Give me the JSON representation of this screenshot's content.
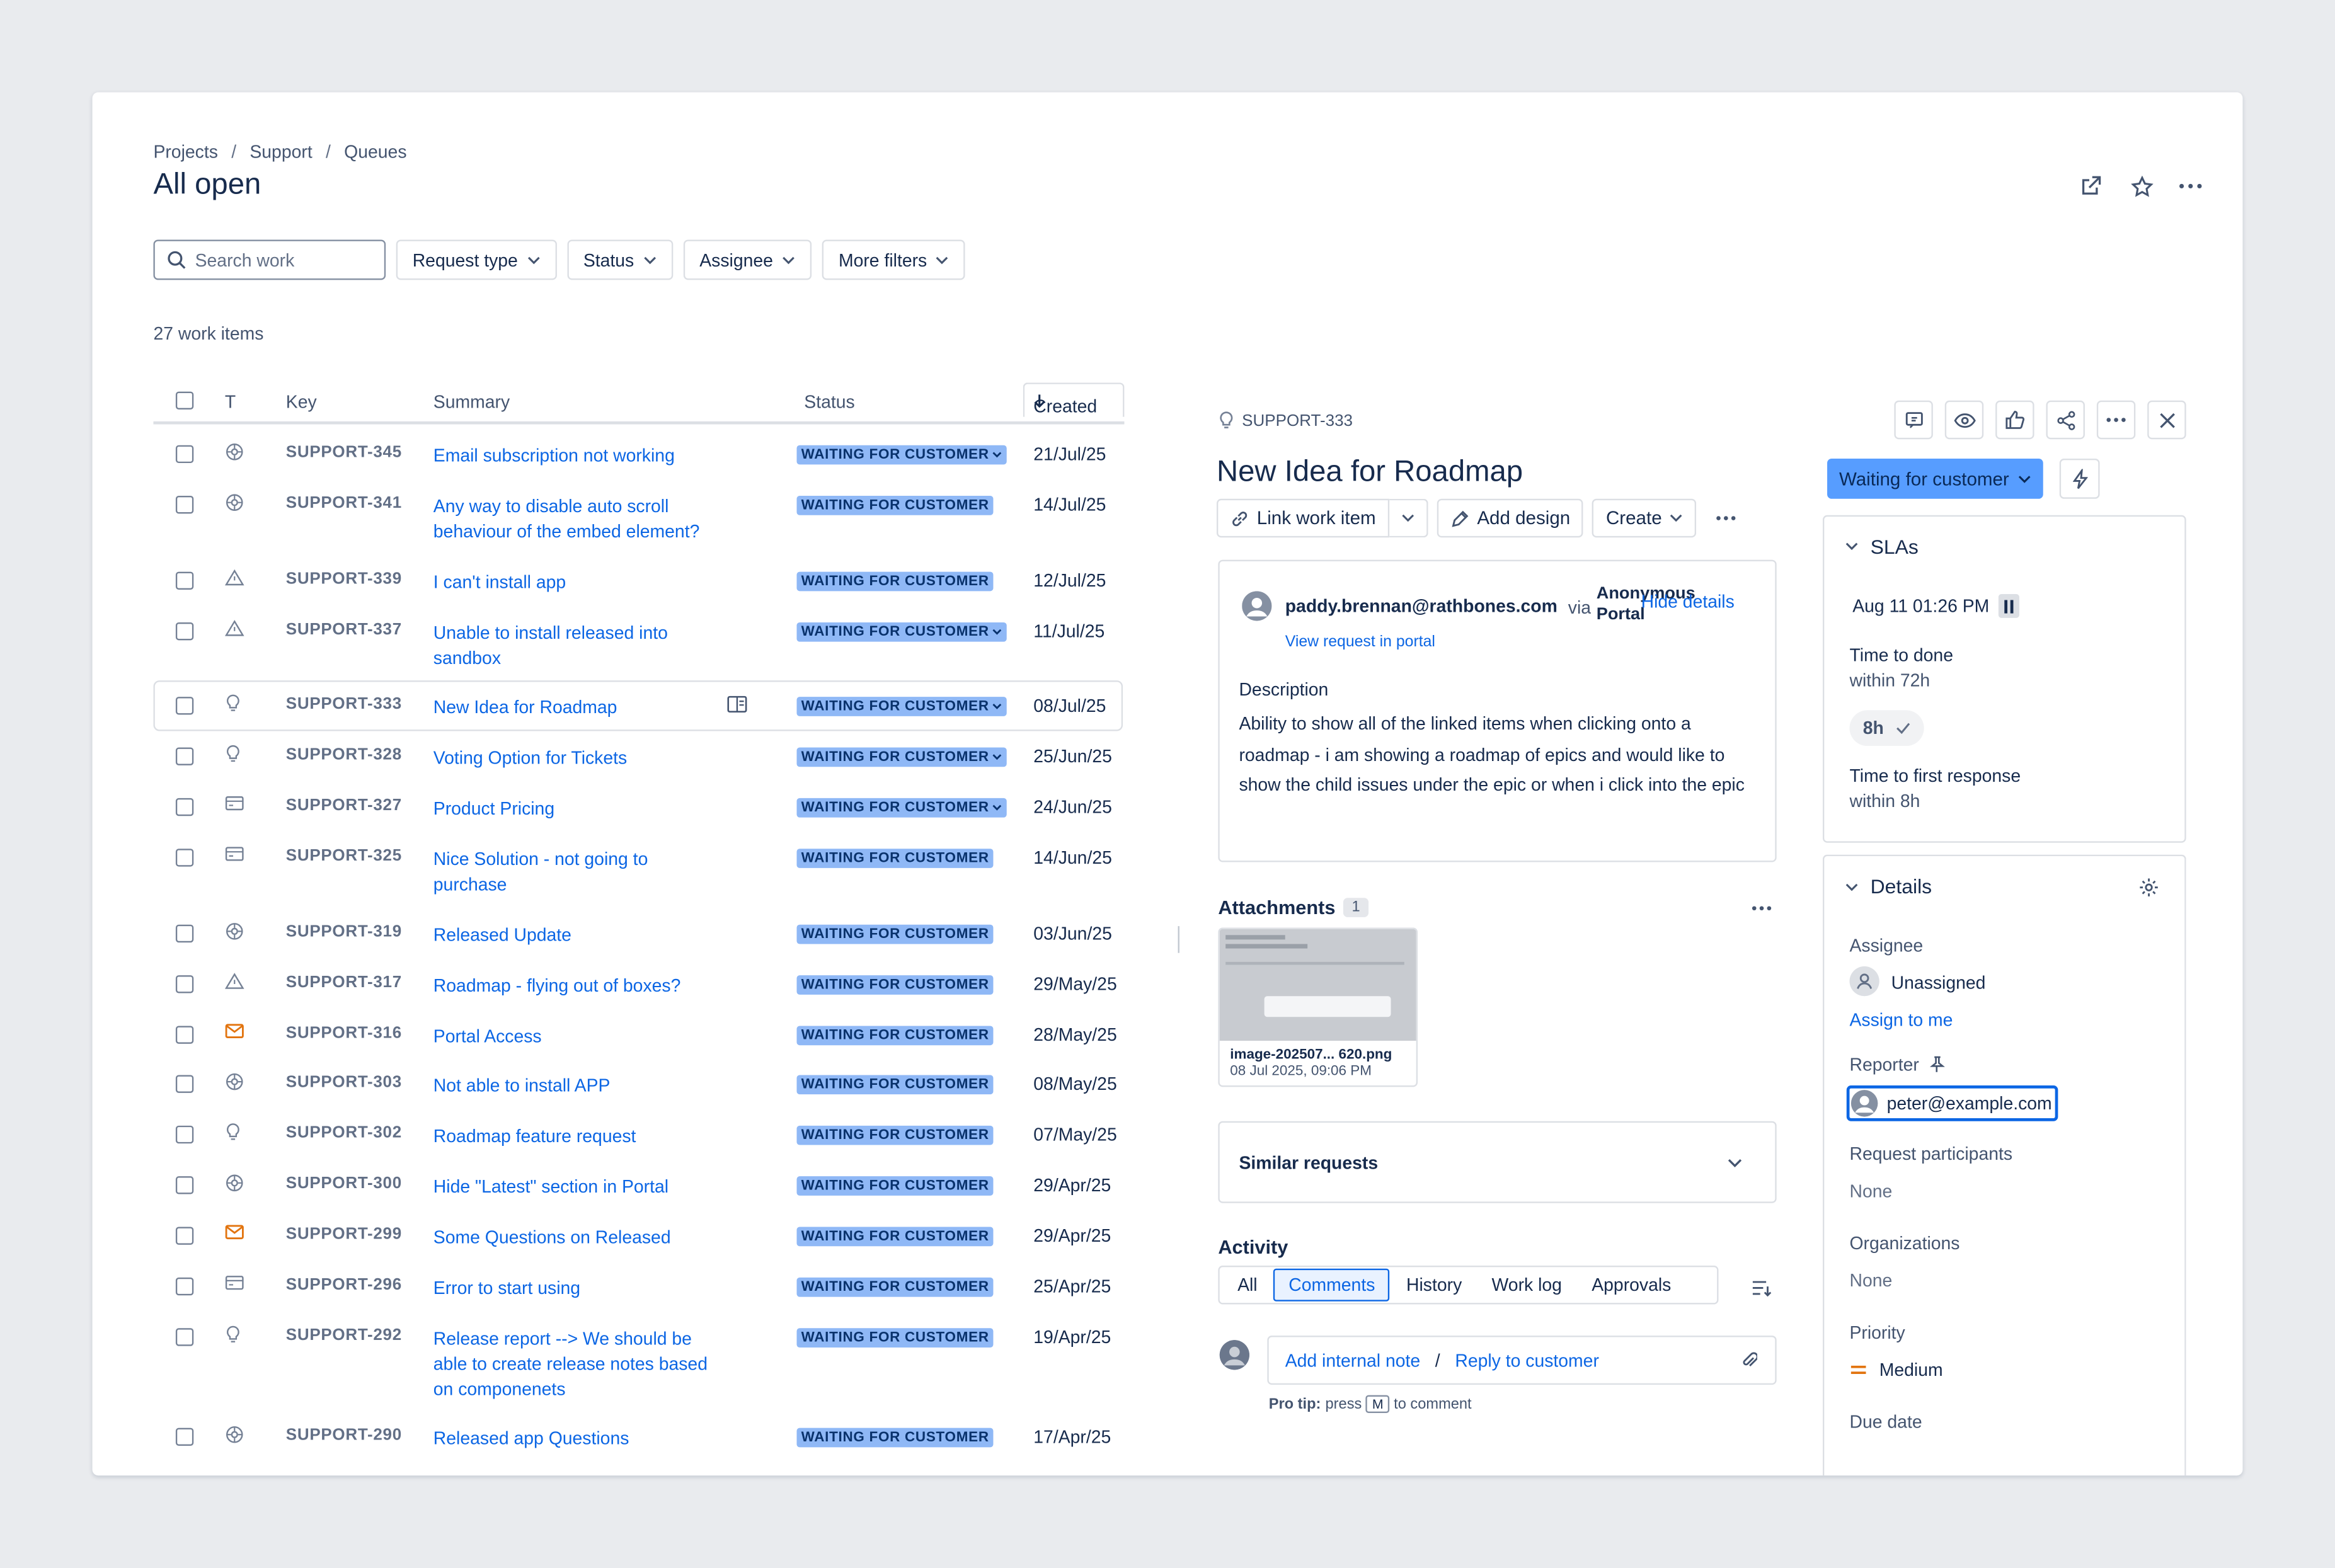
{
  "breadcrumbs": [
    "Projects",
    "Support",
    "Queues"
  ],
  "page_title": "All open",
  "filters": {
    "search_placeholder": "Search work",
    "buttons": [
      "Request type",
      "Status",
      "Assignee",
      "More filters"
    ]
  },
  "item_count": "27 work items",
  "table": {
    "headers": {
      "type": "T",
      "key": "Key",
      "summary": "Summary",
      "status": "Status",
      "created": "Created"
    },
    "rows": [
      {
        "type": "cog",
        "key": "SUPPORT-345",
        "summary": "Email subscription not working",
        "status": "WAITING FOR CUSTOMER",
        "dropdown": true,
        "created": "21/Jul/25"
      },
      {
        "type": "cog",
        "key": "SUPPORT-341",
        "summary": "Any way to disable auto scroll behaviour of the embed element?",
        "status": "WAITING FOR CUSTOMER",
        "dropdown": false,
        "created": "14/Jul/25"
      },
      {
        "type": "warning",
        "key": "SUPPORT-339",
        "summary": "I can't install app",
        "status": "WAITING FOR CUSTOMER",
        "dropdown": false,
        "created": "12/Jul/25"
      },
      {
        "type": "warning",
        "key": "SUPPORT-337",
        "summary": "Unable to install released into sandbox",
        "status": "WAITING FOR CUSTOMER",
        "dropdown": true,
        "created": "11/Jul/25"
      },
      {
        "type": "bulb",
        "key": "SUPPORT-333",
        "summary": "New Idea for Roadmap",
        "status": "WAITING FOR CUSTOMER",
        "dropdown": true,
        "created": "08/Jul/25"
      },
      {
        "type": "bulb",
        "key": "SUPPORT-328",
        "summary": "Voting Option for Tickets",
        "status": "WAITING FOR CUSTOMER",
        "dropdown": true,
        "created": "25/Jun/25"
      },
      {
        "type": "card",
        "key": "SUPPORT-327",
        "summary": "Product Pricing",
        "status": "WAITING FOR CUSTOMER",
        "dropdown": true,
        "created": "24/Jun/25"
      },
      {
        "type": "card",
        "key": "SUPPORT-325",
        "summary": "Nice Solution - not going to purchase",
        "status": "WAITING FOR CUSTOMER",
        "dropdown": false,
        "created": "14/Jun/25"
      },
      {
        "type": "cog",
        "key": "SUPPORT-319",
        "summary": "Released Update",
        "status": "WAITING FOR CUSTOMER",
        "dropdown": false,
        "created": "03/Jun/25"
      },
      {
        "type": "warning",
        "key": "SUPPORT-317",
        "summary": "Roadmap - flying out of boxes?",
        "status": "WAITING FOR CUSTOMER",
        "dropdown": false,
        "created": "29/May/25"
      },
      {
        "type": "mail",
        "key": "SUPPORT-316",
        "summary": "Portal Access",
        "status": "WAITING FOR CUSTOMER",
        "dropdown": false,
        "created": "28/May/25"
      },
      {
        "type": "cog",
        "key": "SUPPORT-303",
        "summary": "Not able to install APP",
        "status": "WAITING FOR CUSTOMER",
        "dropdown": false,
        "created": "08/May/25"
      },
      {
        "type": "bulb",
        "key": "SUPPORT-302",
        "summary": "Roadmap feature request",
        "status": "WAITING FOR CUSTOMER",
        "dropdown": false,
        "created": "07/May/25"
      },
      {
        "type": "cog",
        "key": "SUPPORT-300",
        "summary": "Hide \"Latest\" section in Portal",
        "status": "WAITING FOR CUSTOMER",
        "dropdown": false,
        "created": "29/Apr/25"
      },
      {
        "type": "mail",
        "key": "SUPPORT-299",
        "summary": "Some Questions on Released",
        "status": "WAITING FOR CUSTOMER",
        "dropdown": false,
        "created": "29/Apr/25"
      },
      {
        "type": "card",
        "key": "SUPPORT-296",
        "summary": "Error to start using",
        "status": "WAITING FOR CUSTOMER",
        "dropdown": false,
        "created": "25/Apr/25"
      },
      {
        "type": "bulb",
        "key": "SUPPORT-292",
        "summary": "Release report --> We should be able to create release notes based on componenets",
        "status": "WAITING FOR CUSTOMER",
        "dropdown": false,
        "created": "19/Apr/25"
      },
      {
        "type": "cog",
        "key": "SUPPORT-290",
        "summary": "Released app Questions",
        "status": "WAITING FOR CUSTOMER",
        "dropdown": false,
        "created": "17/Apr/25"
      }
    ]
  },
  "detail": {
    "key": "SUPPORT-333",
    "title": "New Idea for Roadmap",
    "actions": {
      "link": "Link work item",
      "design": "Add design",
      "create": "Create"
    },
    "status_button": "Waiting for customer",
    "reporter_email": "paddy.brennan@rathbones.com",
    "via": "via",
    "channel": "Anonymous Portal",
    "hide_details": "Hide details",
    "view_request": "View request in portal",
    "description_label": "Description",
    "description": "Ability to show all of the linked items when clicking onto a roadmap - i am showing a roadmap of epics and would like to show the child issues under the epic or when i click into the epic",
    "attachments_label": "Attachments",
    "attachments_count": "1",
    "attachment": {
      "name": "image-202507... 620.png",
      "date": "08 Jul 2025, 09:06 PM"
    },
    "similar_requests": "Similar requests",
    "activity_label": "Activity",
    "activity_tabs": [
      "All",
      "Comments",
      "History",
      "Work log",
      "Approvals"
    ],
    "add_internal_note": "Add internal note",
    "slash": "/",
    "reply_to_customer": "Reply to customer",
    "pro_tip_bold": "Pro tip:",
    "pro_tip_press": "press",
    "pro_tip_key": "M",
    "pro_tip_rest": "to comment"
  },
  "slas": {
    "label": "SLAs",
    "date": "Aug 11 01:26 PM",
    "done_title": "Time to done",
    "done_sub": "within 72h",
    "badge": "8h",
    "response_title": "Time to first response",
    "response_sub": "within 8h"
  },
  "details": {
    "label": "Details",
    "assignee_label": "Assignee",
    "assignee_value": "Unassigned",
    "assign_to_me": "Assign to me",
    "reporter_label": "Reporter",
    "reporter_value": "peter@example.com",
    "participants_label": "Request participants",
    "participants_value": "None",
    "organizations_label": "Organizations",
    "organizations_value": "None",
    "priority_label": "Priority",
    "priority_value": "Medium",
    "due_date_label": "Due date"
  },
  "colors": {
    "accent": "#0c66e4",
    "status_badge": "#8fb8f6",
    "status_button": "#579dff",
    "mail_icon": "#e2740f",
    "priority": "#e2740f"
  }
}
